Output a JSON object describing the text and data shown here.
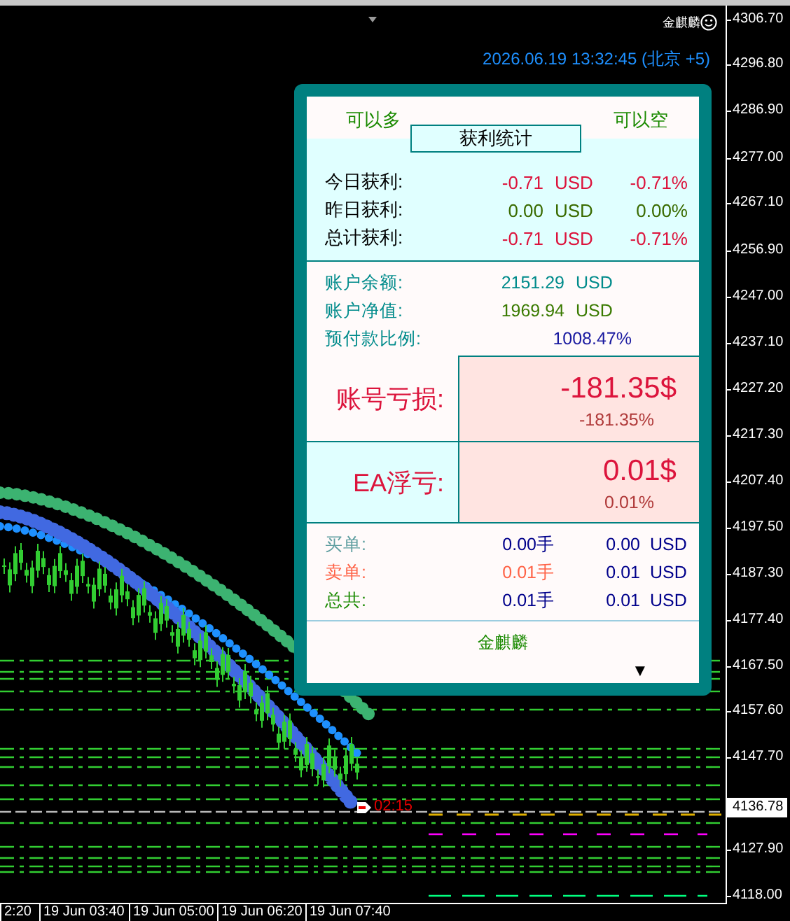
{
  "chart": {
    "brand": "金麒麟",
    "clock": "2026.06.19 13:32:45 (北京 +5)",
    "countdown": "02:15",
    "current_price": "4136.78",
    "price_axis": [
      "4306.70",
      "4296.80",
      "4286.90",
      "4277.00",
      "4267.10",
      "4256.90",
      "4247.00",
      "4237.10",
      "4227.20",
      "4217.30",
      "4207.40",
      "4197.50",
      "4187.30",
      "4177.40",
      "4167.50",
      "4157.60",
      "4147.70",
      "4127.90",
      "4118.00"
    ],
    "time_axis": [
      "2:20",
      "19 Jun 03:40",
      "19 Jun 05:00",
      "19 Jun 06:20",
      "19 Jun 07:40"
    ]
  },
  "panel": {
    "direction_buttons": [
      {
        "label": "可以多"
      },
      {
        "label": "可以空"
      }
    ],
    "section_title": "获利统计",
    "profit_rows": [
      {
        "label": "今日获利:",
        "amount": "-0.71",
        "currency": "USD",
        "percent": "-0.71%",
        "kind": "loss"
      },
      {
        "label": "昨日获利:",
        "amount": "0.00",
        "currency": "USD",
        "percent": "0.00%",
        "kind": "flat"
      },
      {
        "label": "总计获利:",
        "amount": "-0.71",
        "currency": "USD",
        "percent": "-0.71%",
        "kind": "loss"
      }
    ],
    "account_rows": [
      {
        "label": "账户余额:",
        "value": "2151.29",
        "currency": "USD",
        "kind": "balance"
      },
      {
        "label": "账户净值:",
        "value": "1969.94",
        "currency": "USD",
        "kind": "equity"
      },
      {
        "label": "预付款比例:",
        "value": "1008.47%",
        "kind": "margin"
      }
    ],
    "big_rows": [
      {
        "label": "账号亏损:",
        "value": "-181.35$",
        "percent": "-181.35%",
        "kind": "account"
      },
      {
        "label": "EA浮亏:",
        "value": "0.01$",
        "percent": "0.01%",
        "kind": "ea"
      }
    ],
    "order_rows": [
      {
        "label": "买单:",
        "lots": "0.00手",
        "amount": "0.00",
        "currency": "USD",
        "kind": "buy"
      },
      {
        "label": "卖单:",
        "lots": "0.01手",
        "amount": "0.01",
        "currency": "USD",
        "kind": "sell"
      },
      {
        "label": "总共:",
        "lots": "0.01手",
        "amount": "0.01",
        "currency": "USD",
        "kind": "total"
      }
    ],
    "footer": {
      "brand": "金麒麟",
      "toggle": "▼"
    }
  }
}
